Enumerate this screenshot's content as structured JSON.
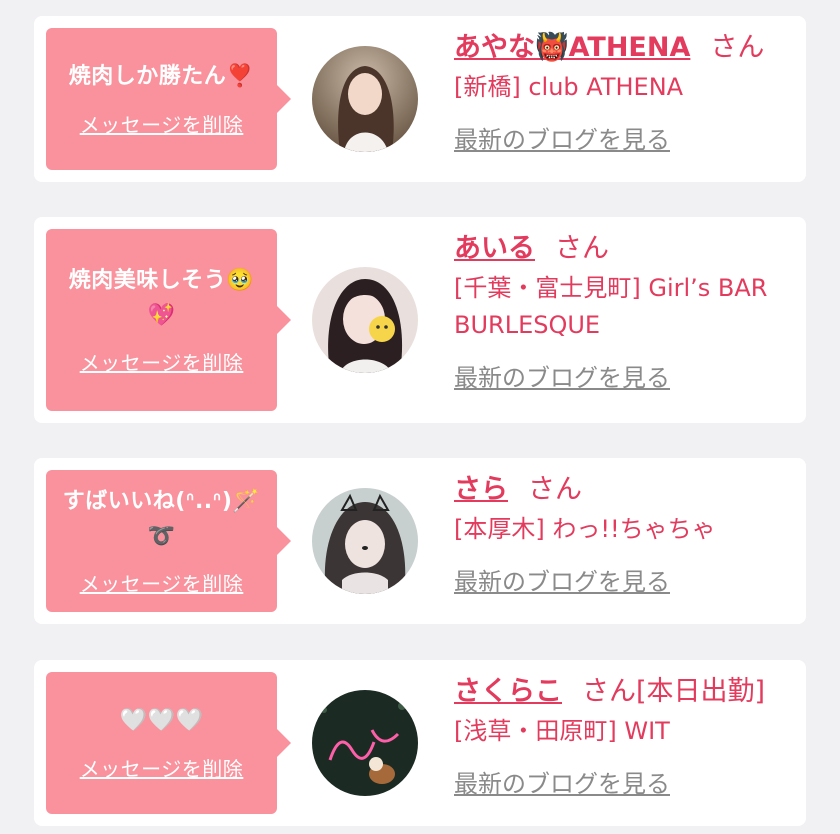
{
  "colors": {
    "accent": "#e23b5d",
    "bubble": "#f9929c",
    "link_gray": "#8a8a8a"
  },
  "cards": [
    {
      "message": "焼肉しか勝たん❣️",
      "delete_label": "メッセージを削除",
      "name": "あやな👹ATHENA",
      "honorific": "さん",
      "suffix": "",
      "shop": "[新橋] club ATHENA",
      "blog_link": "最新のブログを見る"
    },
    {
      "message": "焼肉美味しそう🥹💖",
      "delete_label": "メッセージを削除",
      "name": "あいる",
      "honorific": "さん",
      "suffix": "",
      "shop": "[千葉・富士見町] Girl’s BAR BURLESQUE",
      "blog_link": "最新のブログを見る"
    },
    {
      "message": "すばいいね(ᐢ..ᐢ)🪄➰",
      "delete_label": "メッセージを削除",
      "name": "さら",
      "honorific": "さん",
      "suffix": "",
      "shop": "[本厚木] わっ!!ちゃちゃ",
      "blog_link": "最新のブログを見る"
    },
    {
      "message": "🤍🤍🤍",
      "delete_label": "メッセージを削除",
      "name": "さくらこ",
      "honorific": "さん",
      "suffix": "[本日出勤]",
      "shop": "[浅草・田原町] WIT",
      "blog_link": "最新のブログを見る"
    }
  ]
}
